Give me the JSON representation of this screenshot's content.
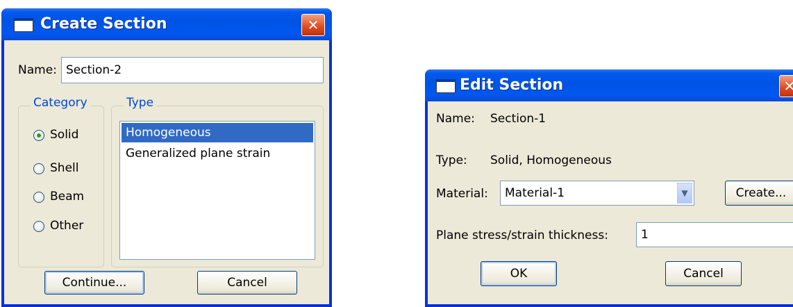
{
  "create_section": {
    "title": "Create Section",
    "name_label": "Name:",
    "name_value": "Section-2",
    "category_legend": "Category",
    "categories": [
      {
        "label": "Solid",
        "selected": true
      },
      {
        "label": "Shell",
        "selected": false
      },
      {
        "label": "Beam",
        "selected": false
      },
      {
        "label": "Other",
        "selected": false
      }
    ],
    "type_legend": "Type",
    "types": [
      {
        "label": "Homogeneous",
        "selected": true
      },
      {
        "label": "Generalized plane strain",
        "selected": false
      }
    ],
    "continue_label": "Continue...",
    "cancel_label": "Cancel",
    "close_glyph": "✕"
  },
  "edit_section": {
    "title": "Edit Section",
    "name_label": "Name:",
    "name_value": "Section-1",
    "type_label": "Type:",
    "type_value": "Solid, Homogeneous",
    "material_label": "Material:",
    "material_value": "Material-1",
    "create_label": "Create...",
    "thickness_label": "Plane stress/strain thickness:",
    "thickness_value": "1",
    "ok_label": "OK",
    "cancel_label": "Cancel",
    "close_glyph": "✕"
  }
}
